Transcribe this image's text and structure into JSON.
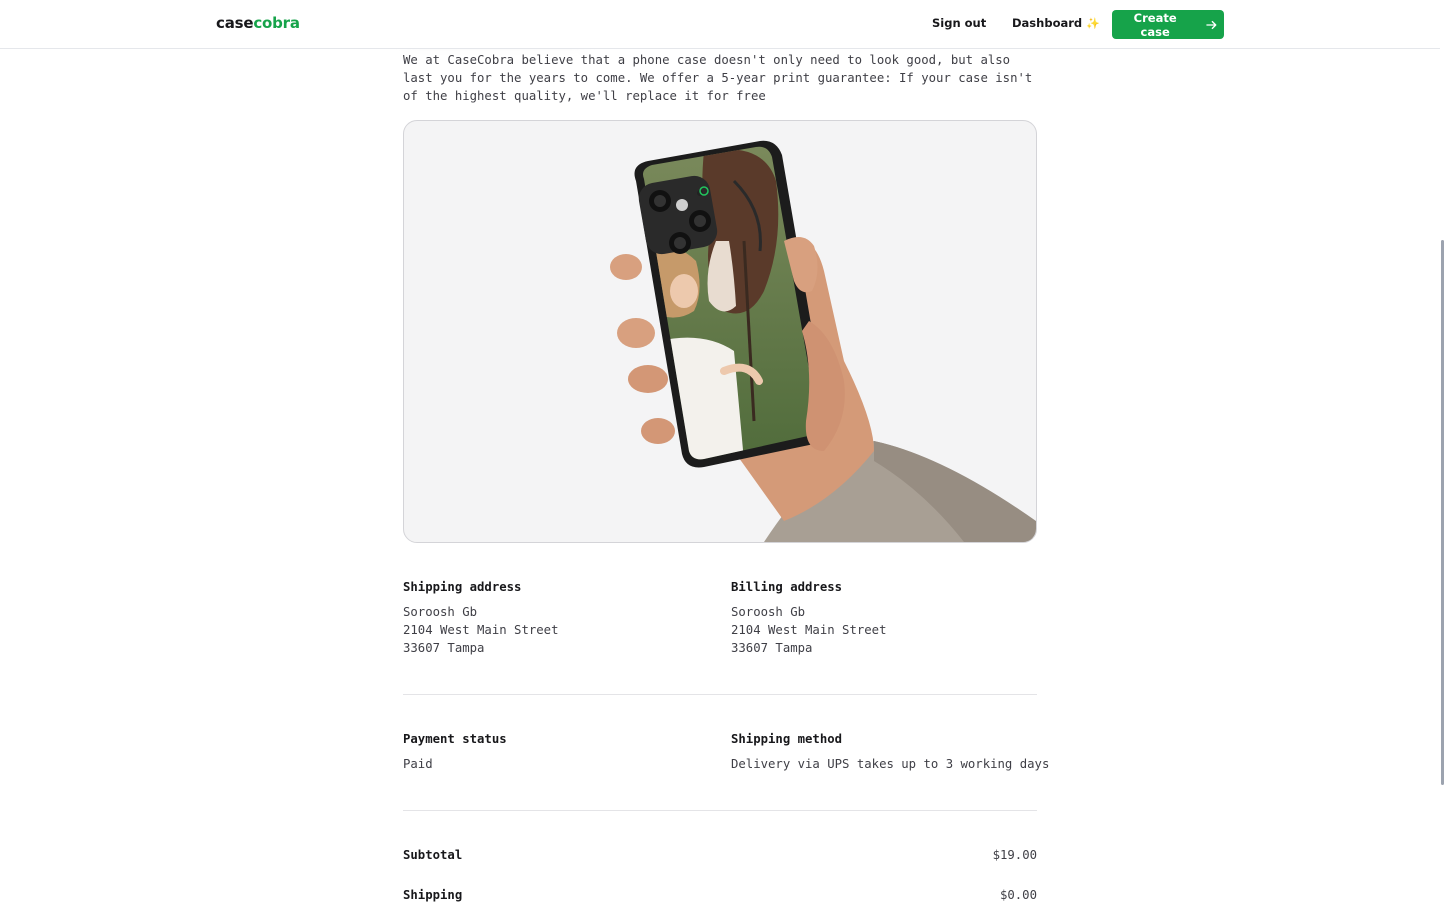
{
  "navbar": {
    "logo_prefix": "case",
    "logo_accent": "cobra",
    "sign_out": "Sign out",
    "dashboard": "Dashboard",
    "dashboard_icon": "sparkles-icon",
    "create_case": "Create case",
    "create_case_icon": "arrow-right-icon"
  },
  "intro_text": "We at CaseCobra believe that a phone case doesn't only need to look good, but also last you for the years to come. We offer a 5-year print guarantee: If your case isn't of the highest quality, we'll replace it for free",
  "shipping_address": {
    "label": "Shipping address",
    "name": "Soroosh Gb",
    "street": "2104 West Main Street",
    "city": "33607 Tampa"
  },
  "billing_address": {
    "label": "Billing address",
    "name": "Soroosh Gb",
    "street": "2104 West Main Street",
    "city": "33607 Tampa"
  },
  "payment": {
    "label": "Payment status",
    "value": "Paid"
  },
  "shipping_method": {
    "label": "Shipping method",
    "value": "Delivery via UPS takes up to 3 working days"
  },
  "totals": {
    "subtotal_label": "Subtotal",
    "subtotal_value": "$19.00",
    "shipping_label": "Shipping",
    "shipping_value": "$0.00"
  },
  "colors": {
    "brand_green": "#16a34a",
    "text_dark": "#18181b",
    "text_muted": "#3f3f46"
  }
}
